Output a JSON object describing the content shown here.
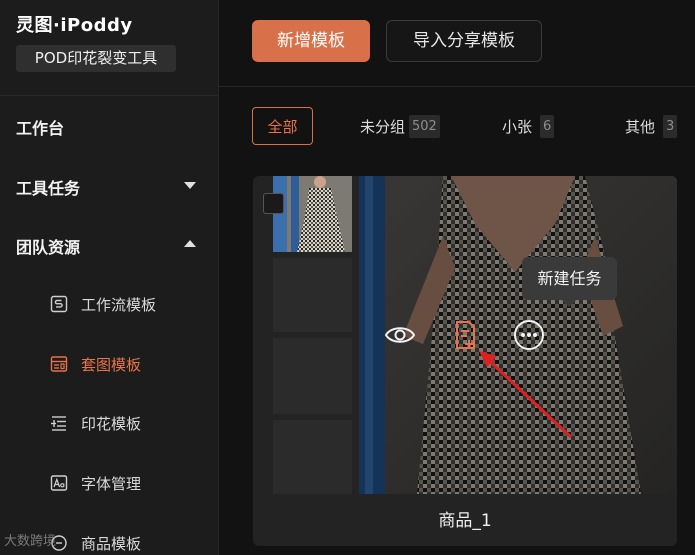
{
  "sidebar": {
    "brand": "灵图·iPoddy",
    "badge": "POD印花裂变工具",
    "nav": {
      "workbench": "工作台",
      "tool_tasks": "工具任务",
      "team_resources": "团队资源"
    },
    "sub_items": [
      {
        "label": "工作流模板",
        "icon": "workflow-template-icon",
        "active": false
      },
      {
        "label": "套图模板",
        "icon": "set-template-icon",
        "active": true
      },
      {
        "label": "印花模板",
        "icon": "print-template-icon",
        "active": false
      },
      {
        "label": "字体管理",
        "icon": "font-icon",
        "active": false
      },
      {
        "label": "商品模板",
        "icon": "product-template-icon",
        "active": false
      }
    ],
    "watermark": "大数跨境"
  },
  "toolbar": {
    "new_template": "新增模板",
    "import_shared": "导入分享模板"
  },
  "filters": [
    {
      "label": "全部",
      "count": null,
      "active": true
    },
    {
      "label": "未分组",
      "count": "502",
      "active": false
    },
    {
      "label": "小张",
      "count": "6",
      "active": false
    },
    {
      "label": "其他",
      "count": "3",
      "active": false
    }
  ],
  "card": {
    "title": "商品_1",
    "tooltip": "新建任务",
    "actions": [
      "eye-icon",
      "new-task-icon",
      "more-icon"
    ]
  },
  "colors": {
    "accent": "#d8714a",
    "annotation_arrow": "#e02020"
  }
}
